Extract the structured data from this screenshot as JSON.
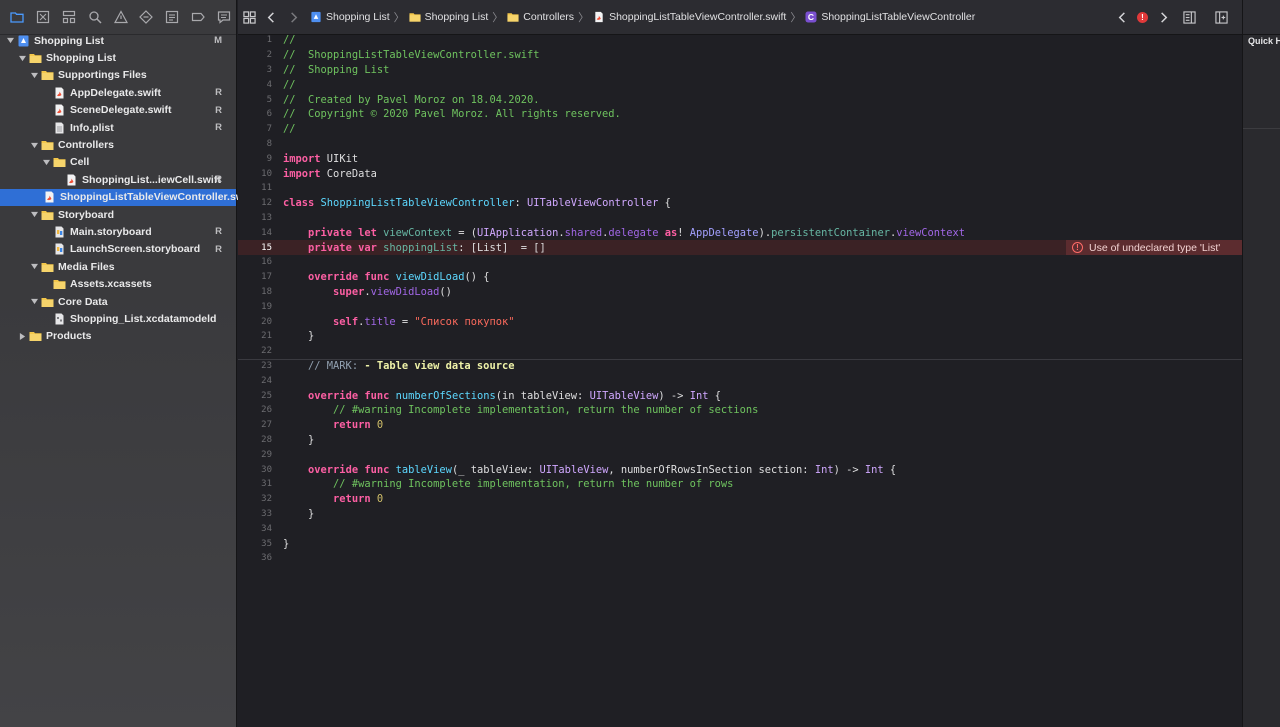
{
  "colors": {
    "folder": "#f3c74b",
    "selection": "#2f6fd6",
    "error": "#e0393a"
  },
  "navigator": {
    "toolbar_icons": [
      "folder-icon",
      "source-control-icon",
      "hierarchy-icon",
      "find-icon",
      "issue-warning-icon",
      "test-diamond-icon",
      "debug-icon",
      "breakpoint-icon",
      "report-icon"
    ],
    "items": [
      {
        "label": "Shopping List",
        "icon": "project-icon",
        "depth": 0,
        "expanded": true,
        "status": "M",
        "selected": false
      },
      {
        "label": "Shopping List",
        "icon": "folder-icon",
        "depth": 1,
        "expanded": true,
        "status": "",
        "selected": false
      },
      {
        "label": "Supportings Files",
        "icon": "folder-icon",
        "depth": 2,
        "expanded": true,
        "status": "",
        "selected": false
      },
      {
        "label": "AppDelegate.swift",
        "icon": "swift-file-icon",
        "depth": 3,
        "expanded": null,
        "status": "R",
        "selected": false
      },
      {
        "label": "SceneDelegate.swift",
        "icon": "swift-file-icon",
        "depth": 3,
        "expanded": null,
        "status": "R",
        "selected": false
      },
      {
        "label": "Info.plist",
        "icon": "plist-file-icon",
        "depth": 3,
        "expanded": null,
        "status": "R",
        "selected": false
      },
      {
        "label": "Controllers",
        "icon": "folder-icon",
        "depth": 2,
        "expanded": true,
        "status": "",
        "selected": false
      },
      {
        "label": "Cell",
        "icon": "folder-icon",
        "depth": 3,
        "expanded": true,
        "status": "",
        "selected": false
      },
      {
        "label": "ShoppingList...iewCell.swift",
        "icon": "swift-file-icon",
        "depth": 4,
        "expanded": null,
        "status": "R",
        "selected": false
      },
      {
        "label": "ShoppingListTableViewController.swift",
        "icon": "swift-file-icon",
        "depth": 3,
        "expanded": null,
        "status": "",
        "selected": true
      },
      {
        "label": "Storyboard",
        "icon": "folder-icon",
        "depth": 2,
        "expanded": true,
        "status": "",
        "selected": false
      },
      {
        "label": "Main.storyboard",
        "icon": "storyboard-file-icon",
        "depth": 3,
        "expanded": null,
        "status": "R",
        "selected": false
      },
      {
        "label": "LaunchScreen.storyboard",
        "icon": "storyboard-file-icon",
        "depth": 3,
        "expanded": null,
        "status": "R",
        "selected": false
      },
      {
        "label": "Media Files",
        "icon": "folder-icon",
        "depth": 2,
        "expanded": true,
        "status": "",
        "selected": false
      },
      {
        "label": "Assets.xcassets",
        "icon": "folder-icon",
        "depth": 3,
        "expanded": null,
        "status": "",
        "selected": false
      },
      {
        "label": "Core Data",
        "icon": "folder-icon",
        "depth": 2,
        "expanded": true,
        "status": "",
        "selected": false
      },
      {
        "label": "Shopping_List.xcdatamodeld",
        "icon": "datamodel-file-icon",
        "depth": 3,
        "expanded": null,
        "status": "",
        "selected": false
      },
      {
        "label": "Products",
        "icon": "folder-icon",
        "depth": 1,
        "expanded": false,
        "status": "",
        "selected": false
      }
    ]
  },
  "jumpbar": {
    "crumbs": [
      {
        "label": "Shopping List",
        "icon": "project-icon"
      },
      {
        "label": "Shopping List",
        "icon": "folder-icon"
      },
      {
        "label": "Controllers",
        "icon": "folder-icon"
      },
      {
        "label": "ShoppingListTableViewController.swift",
        "icon": "swift-file-icon"
      },
      {
        "label": "ShoppingListTableViewController",
        "icon": "class-icon"
      }
    ],
    "class_badge": "C",
    "error_count": "!"
  },
  "editor": {
    "current_line": 15,
    "error_line": 15,
    "error_message": "Use of undeclared type 'List'",
    "lines": [
      {
        "n": 1,
        "tokens": [
          {
            "t": "//",
            "c": "comment"
          }
        ]
      },
      {
        "n": 2,
        "tokens": [
          {
            "t": "//  ShoppingListTableViewController.swift",
            "c": "comment"
          }
        ]
      },
      {
        "n": 3,
        "tokens": [
          {
            "t": "//  Shopping List",
            "c": "comment"
          }
        ]
      },
      {
        "n": 4,
        "tokens": [
          {
            "t": "//",
            "c": "comment"
          }
        ]
      },
      {
        "n": 5,
        "tokens": [
          {
            "t": "//  Created by Pavel Moroz on 18.04.2020.",
            "c": "comment"
          }
        ]
      },
      {
        "n": 6,
        "tokens": [
          {
            "t": "//  Copyright © 2020 Pavel Moroz. All rights reserved.",
            "c": "comment"
          }
        ]
      },
      {
        "n": 7,
        "tokens": [
          {
            "t": "//",
            "c": "comment"
          }
        ]
      },
      {
        "n": 8,
        "tokens": []
      },
      {
        "n": 9,
        "tokens": [
          {
            "t": "import",
            "c": "keyword"
          },
          {
            "t": " UIKit",
            "c": "plain"
          }
        ]
      },
      {
        "n": 10,
        "tokens": [
          {
            "t": "import",
            "c": "keyword"
          },
          {
            "t": " CoreData",
            "c": "plain"
          }
        ]
      },
      {
        "n": 11,
        "tokens": []
      },
      {
        "n": 12,
        "tokens": [
          {
            "t": "class",
            "c": "keyword"
          },
          {
            "t": " ",
            "c": "plain"
          },
          {
            "t": "ShoppingListTableViewController",
            "c": "decl"
          },
          {
            "t": ": ",
            "c": "plain"
          },
          {
            "t": "UITableViewController",
            "c": "type"
          },
          {
            "t": " {",
            "c": "plain"
          }
        ]
      },
      {
        "n": 13,
        "tokens": []
      },
      {
        "n": 14,
        "tokens": [
          {
            "t": "    ",
            "c": "plain"
          },
          {
            "t": "private",
            "c": "keyword"
          },
          {
            "t": " ",
            "c": "plain"
          },
          {
            "t": "let",
            "c": "keyword"
          },
          {
            "t": " ",
            "c": "plain"
          },
          {
            "t": "viewContext",
            "c": "method"
          },
          {
            "t": " = (",
            "c": "plain"
          },
          {
            "t": "UIApplication",
            "c": "type"
          },
          {
            "t": ".",
            "c": "plain"
          },
          {
            "t": "shared",
            "c": "prop"
          },
          {
            "t": ".",
            "c": "plain"
          },
          {
            "t": "delegate",
            "c": "prop"
          },
          {
            "t": " ",
            "c": "plain"
          },
          {
            "t": "as",
            "c": "keyword"
          },
          {
            "t": "! ",
            "c": "plain"
          },
          {
            "t": "AppDelegate",
            "c": "member"
          },
          {
            "t": ").",
            "c": "plain"
          },
          {
            "t": "persistentContainer",
            "c": "method"
          },
          {
            "t": ".",
            "c": "plain"
          },
          {
            "t": "viewContext",
            "c": "prop"
          }
        ]
      },
      {
        "n": 15,
        "tokens": [
          {
            "t": "    ",
            "c": "plain"
          },
          {
            "t": "private",
            "c": "keyword"
          },
          {
            "t": " ",
            "c": "plain"
          },
          {
            "t": "var",
            "c": "keyword"
          },
          {
            "t": " ",
            "c": "plain"
          },
          {
            "t": "shoppingList",
            "c": "method"
          },
          {
            "t": ": [List]  = []",
            "c": "plain"
          }
        ]
      },
      {
        "n": 16,
        "tokens": []
      },
      {
        "n": 17,
        "tokens": [
          {
            "t": "    ",
            "c": "plain"
          },
          {
            "t": "override",
            "c": "keyword"
          },
          {
            "t": " ",
            "c": "plain"
          },
          {
            "t": "func",
            "c": "keyword"
          },
          {
            "t": " ",
            "c": "plain"
          },
          {
            "t": "viewDidLoad",
            "c": "decl"
          },
          {
            "t": "() {",
            "c": "plain"
          }
        ]
      },
      {
        "n": 18,
        "tokens": [
          {
            "t": "        ",
            "c": "plain"
          },
          {
            "t": "super",
            "c": "keyword"
          },
          {
            "t": ".",
            "c": "plain"
          },
          {
            "t": "viewDidLoad",
            "c": "prop"
          },
          {
            "t": "()",
            "c": "plain"
          }
        ]
      },
      {
        "n": 19,
        "tokens": []
      },
      {
        "n": 20,
        "tokens": [
          {
            "t": "        ",
            "c": "plain"
          },
          {
            "t": "self",
            "c": "keyword"
          },
          {
            "t": ".",
            "c": "plain"
          },
          {
            "t": "title",
            "c": "prop"
          },
          {
            "t": " = ",
            "c": "plain"
          },
          {
            "t": "\"Список покупок\"",
            "c": "string"
          }
        ]
      },
      {
        "n": 21,
        "tokens": [
          {
            "t": "    }",
            "c": "plain"
          }
        ]
      },
      {
        "n": 22,
        "tokens": []
      },
      {
        "n": 23,
        "tokens": [
          {
            "t": "    // MARK: ",
            "c": "mark"
          },
          {
            "t": "- Table view data source",
            "c": "markb"
          }
        ]
      },
      {
        "n": 24,
        "tokens": []
      },
      {
        "n": 25,
        "tokens": [
          {
            "t": "    ",
            "c": "plain"
          },
          {
            "t": "override",
            "c": "keyword"
          },
          {
            "t": " ",
            "c": "plain"
          },
          {
            "t": "func",
            "c": "keyword"
          },
          {
            "t": " ",
            "c": "plain"
          },
          {
            "t": "numberOfSections",
            "c": "decl"
          },
          {
            "t": "(in tableView: ",
            "c": "plain"
          },
          {
            "t": "UITableView",
            "c": "type"
          },
          {
            "t": ") -> ",
            "c": "plain"
          },
          {
            "t": "Int",
            "c": "type"
          },
          {
            "t": " {",
            "c": "plain"
          }
        ]
      },
      {
        "n": 26,
        "tokens": [
          {
            "t": "        // #warning Incomplete implementation, return the number of sections",
            "c": "comment"
          }
        ]
      },
      {
        "n": 27,
        "tokens": [
          {
            "t": "        ",
            "c": "plain"
          },
          {
            "t": "return",
            "c": "keyword"
          },
          {
            "t": " ",
            "c": "plain"
          },
          {
            "t": "0",
            "c": "number"
          }
        ]
      },
      {
        "n": 28,
        "tokens": [
          {
            "t": "    }",
            "c": "plain"
          }
        ]
      },
      {
        "n": 29,
        "tokens": []
      },
      {
        "n": 30,
        "tokens": [
          {
            "t": "    ",
            "c": "plain"
          },
          {
            "t": "override",
            "c": "keyword"
          },
          {
            "t": " ",
            "c": "plain"
          },
          {
            "t": "func",
            "c": "keyword"
          },
          {
            "t": " ",
            "c": "plain"
          },
          {
            "t": "tableView",
            "c": "decl"
          },
          {
            "t": "(_ tableView: ",
            "c": "plain"
          },
          {
            "t": "UITableView",
            "c": "type"
          },
          {
            "t": ", numberOfRowsInSection section: ",
            "c": "plain"
          },
          {
            "t": "Int",
            "c": "type"
          },
          {
            "t": ") -> ",
            "c": "plain"
          },
          {
            "t": "Int",
            "c": "type"
          },
          {
            "t": " {",
            "c": "plain"
          }
        ]
      },
      {
        "n": 31,
        "tokens": [
          {
            "t": "        // #warning Incomplete implementation, return the number of rows",
            "c": "comment"
          }
        ]
      },
      {
        "n": 32,
        "tokens": [
          {
            "t": "        ",
            "c": "plain"
          },
          {
            "t": "return",
            "c": "keyword"
          },
          {
            "t": " ",
            "c": "plain"
          },
          {
            "t": "0",
            "c": "number"
          }
        ]
      },
      {
        "n": 33,
        "tokens": [
          {
            "t": "    }",
            "c": "plain"
          }
        ]
      },
      {
        "n": 34,
        "tokens": []
      },
      {
        "n": 35,
        "tokens": [
          {
            "t": "}",
            "c": "plain"
          }
        ]
      },
      {
        "n": 36,
        "tokens": []
      }
    ]
  },
  "inspector": {
    "title": "Quick H"
  }
}
